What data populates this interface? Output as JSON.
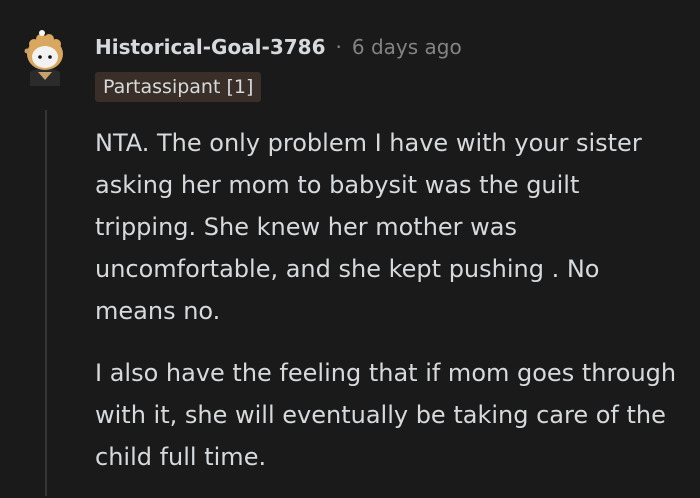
{
  "comment": {
    "username": "Historical-Goal-3786",
    "separator": "·",
    "timestamp": "6 days ago",
    "flair": "Partassipant [1]",
    "paragraphs": [
      "NTA. The only problem I have with your sister asking her mom to babysit was the guilt tripping. She knew her mother was uncomfortable, and she kept pushing . No means no.",
      "I also have the feeling that if mom goes through with it, she will eventually be taking care of the child full time."
    ]
  },
  "colors": {
    "background": "#1a1a1b",
    "text": "#d7dadc",
    "meta": "#818384",
    "flair_bg": "#3a2f28",
    "thread_line": "#343536"
  }
}
